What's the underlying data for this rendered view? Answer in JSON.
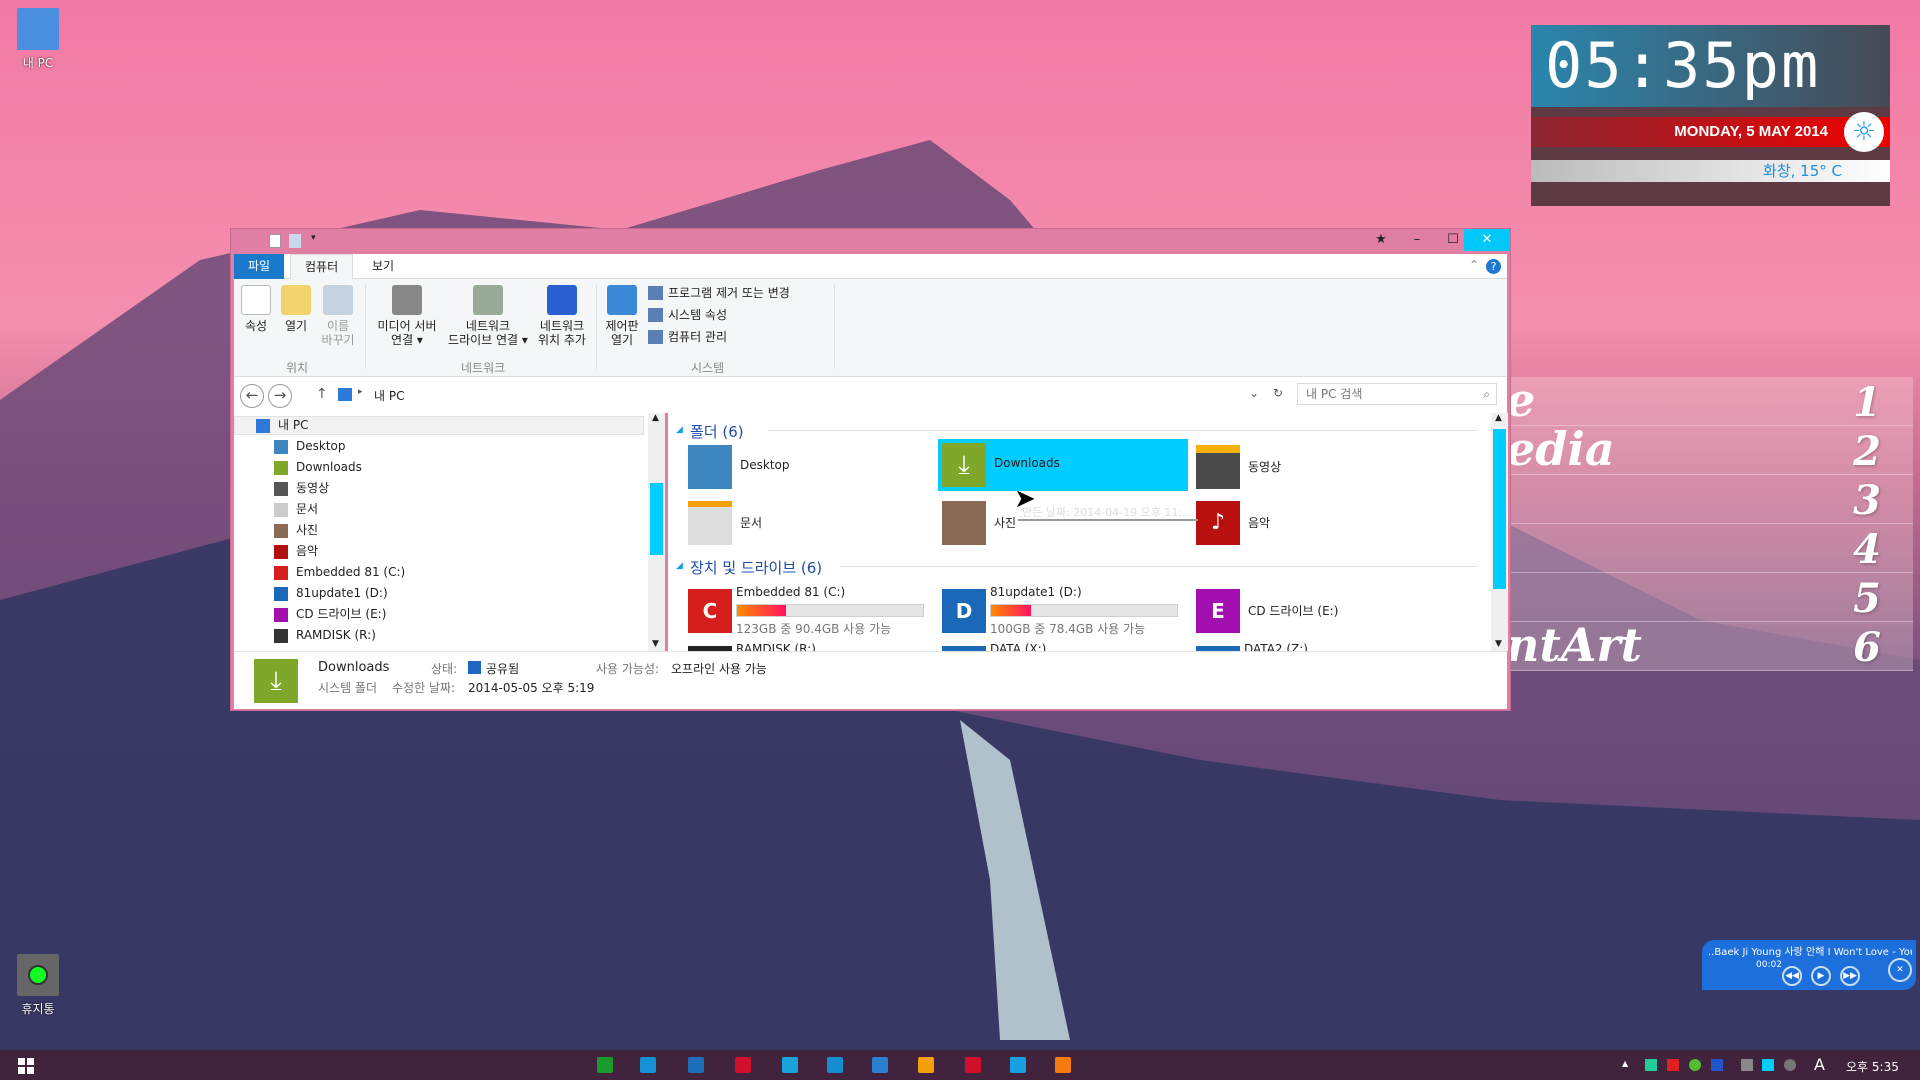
{
  "desktop": {
    "icons": [
      {
        "label": "내 PC",
        "icon": "computer-icon"
      },
      {
        "label": "휴지통",
        "icon": "recycle-bin-icon"
      }
    ]
  },
  "clock": {
    "time": "05:35pm",
    "date": "MONDAY, 5 MAY 2014",
    "weather": "화창, 15° C",
    "weather_icon": "sun-icon"
  },
  "tiles": {
    "labels": [
      "e",
      "edia",
      "",
      "",
      "",
      "ntArt"
    ],
    "numbers": [
      "1",
      "2",
      "3",
      "4",
      "5",
      "6"
    ]
  },
  "window": {
    "controls": {
      "pin": "★",
      "minimize": "–",
      "maximize": "☐",
      "close": "✕"
    },
    "tabs": [
      "파일",
      "컴퓨터",
      "보기"
    ],
    "ribbon": {
      "groups": [
        {
          "label": "위치",
          "buttons": [
            "속성",
            "열기",
            "이름\n바꾸기"
          ]
        },
        {
          "label": "네트워크",
          "buttons": [
            "미디어 서버\n연결 ▾",
            "네트워크\n드라이브 연결 ▾",
            "네트워크\n위치 추가"
          ]
        },
        {
          "label": "시스템",
          "buttons": [
            "제어판\n열기"
          ],
          "small": [
            "프로그램 제거 또는 변경",
            "시스템 속성",
            "컴퓨터 관리"
          ]
        }
      ]
    },
    "address": {
      "path": "내 PC",
      "search_placeholder": "내 PC 검색"
    },
    "nav": {
      "root": "내 PC",
      "items": [
        "Desktop",
        "Downloads",
        "동영상",
        "문서",
        "사진",
        "음악",
        "Embedded 81 (C:)",
        "81update1 (D:)",
        "CD 드라이브 (E:)",
        "RAMDISK (R:)"
      ]
    },
    "content": {
      "folders_header": "폴더 (6)",
      "folders": [
        "Desktop",
        "Downloads",
        "동영상",
        "문서",
        "사진",
        "음악"
      ],
      "selected": "Downloads",
      "tooltip": "만든 날짜: 2014-04-19 오후 11:...",
      "drives_header": "장치 및 드라이브 (6)",
      "drives": [
        {
          "name": "Embedded 81 (C:)",
          "letter": "C",
          "caption": "123GB 중 90.4GB 사용 가능",
          "used_fraction": 0.265,
          "color": "#d61e1e"
        },
        {
          "name": "81update1 (D:)",
          "letter": "D",
          "caption": "100GB 중 78.4GB 사용 가능",
          "used_fraction": 0.216,
          "color": "#1c68b8"
        },
        {
          "name": "CD 드라이브 (E:)",
          "letter": "E",
          "color": "#a10fae"
        },
        {
          "name": "RAMDISK (R:)"
        },
        {
          "name": "DATA (X:)"
        },
        {
          "name": "DATA2 (Z:)"
        }
      ]
    },
    "status": {
      "name": "Downloads",
      "type": "시스템 폴더",
      "state_label": "상태:",
      "state_value": "공유됨",
      "modified_label": "수정한 날짜:",
      "modified_value": "2014-05-05 오후 5:19",
      "avail_label": "사용 가능성:",
      "avail_value": "오프라인 사용 가능"
    }
  },
  "media": {
    "title": "..Baek Ji Young 사랑 안해 I Won't Love - YouTube",
    "time": "00:02"
  },
  "taskbar": {
    "clock": "오후 5:35",
    "ime": "A",
    "apps": [
      "#1a9a2a",
      "#1591d6",
      "#1c6fb8",
      "#d0102a",
      "#1aa3d8",
      "#148ed0",
      "#2a7fd0",
      "#f5a00a",
      "#d0102a",
      "#19a0e0",
      "#f57a10"
    ]
  }
}
